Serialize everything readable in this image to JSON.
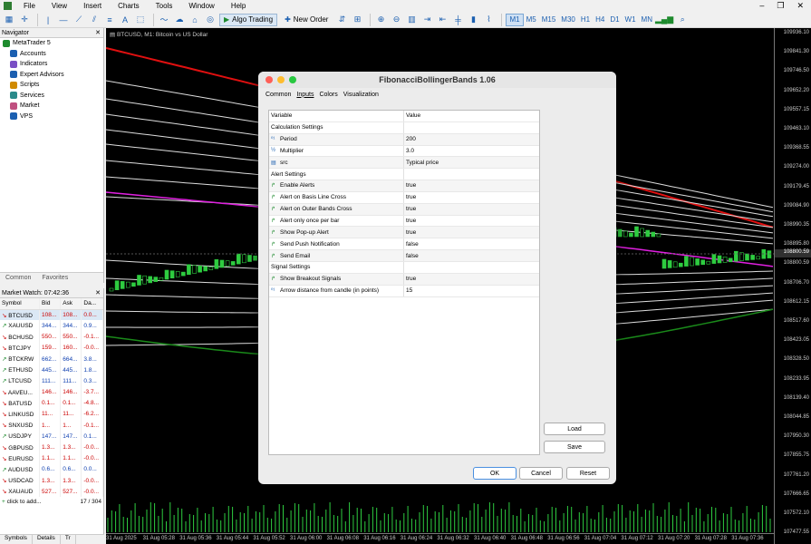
{
  "menu": {
    "items": [
      "File",
      "View",
      "Insert",
      "Charts",
      "Tools",
      "Window",
      "Help"
    ]
  },
  "toolbar": {
    "algo_trading": "Algo Trading",
    "new_order": "New Order",
    "timeframes": [
      "M1",
      "M5",
      "M15",
      "M30",
      "H1",
      "H4",
      "D1",
      "W1",
      "MN"
    ],
    "active_timeframe": "M1"
  },
  "navigator": {
    "title": "Navigator",
    "items": [
      {
        "label": "MetaTrader 5",
        "icon": "terminal-icon"
      },
      {
        "label": "Accounts",
        "icon": "accounts-icon"
      },
      {
        "label": "Indicators",
        "icon": "indicators-icon"
      },
      {
        "label": "Expert Advisors",
        "icon": "expert-advisors-icon"
      },
      {
        "label": "Scripts",
        "icon": "scripts-icon"
      },
      {
        "label": "Services",
        "icon": "services-icon"
      },
      {
        "label": "Market",
        "icon": "market-icon"
      },
      {
        "label": "VPS",
        "icon": "vps-icon"
      }
    ],
    "tabs": [
      "Common",
      "Favorites"
    ]
  },
  "market_watch": {
    "title": "Market Watch: 07:42:36",
    "columns": [
      "Symbol",
      "Bid",
      "Ask",
      "Da..."
    ],
    "rows": [
      {
        "symbol": "BTCUSD",
        "bid": "108...",
        "ask": "108...",
        "day": "0.0...",
        "up": false,
        "sel": true
      },
      {
        "symbol": "XAUUSD",
        "bid": "344...",
        "ask": "344...",
        "day": "0.9...",
        "up": true
      },
      {
        "symbol": "BCHUSD",
        "bid": "550...",
        "ask": "550...",
        "day": "-0.1...",
        "up": false
      },
      {
        "symbol": "BTCJPY",
        "bid": "159...",
        "ask": "160...",
        "day": "-0.0...",
        "up": false
      },
      {
        "symbol": "BTCKRW",
        "bid": "662...",
        "ask": "664...",
        "day": "3.8...",
        "up": true
      },
      {
        "symbol": "ETHUSD",
        "bid": "445...",
        "ask": "445...",
        "day": "1.8...",
        "up": true
      },
      {
        "symbol": "LTCUSD",
        "bid": "111...",
        "ask": "111...",
        "day": "0.3...",
        "up": true
      },
      {
        "symbol": "AAVEU...",
        "bid": "146...",
        "ask": "146...",
        "day": "-3.7...",
        "up": false
      },
      {
        "symbol": "BATUSD",
        "bid": "0.1...",
        "ask": "0.1...",
        "day": "-4.8...",
        "up": false
      },
      {
        "symbol": "LINKUSD",
        "bid": "11...",
        "ask": "11...",
        "day": "-6.2...",
        "up": false
      },
      {
        "symbol": "SNXUSD",
        "bid": "1...",
        "ask": "1...",
        "day": "-0.1...",
        "up": false
      },
      {
        "symbol": "USDJPY",
        "bid": "147...",
        "ask": "147...",
        "day": "0.1...",
        "up": true
      },
      {
        "symbol": "GBPUSD",
        "bid": "1.3...",
        "ask": "1.3...",
        "day": "-0.0...",
        "up": false
      },
      {
        "symbol": "EURUSD",
        "bid": "1.1...",
        "ask": "1.1...",
        "day": "-0.0...",
        "up": false
      },
      {
        "symbol": "AUDUSD",
        "bid": "0.6...",
        "ask": "0.6...",
        "day": "0.0...",
        "up": true
      },
      {
        "symbol": "USDCAD",
        "bid": "1.3...",
        "ask": "1.3...",
        "day": "-0.0...",
        "up": false
      },
      {
        "symbol": "XAUAUD",
        "bid": "527...",
        "ask": "527...",
        "day": "-0.0...",
        "up": false
      }
    ],
    "add_label": "click to add...",
    "count": "17 / 304",
    "tabs": [
      "Symbols",
      "Details",
      "Tr"
    ]
  },
  "chart": {
    "title": "BTCUSD, M1: Bitcoin vs US Dollar",
    "current_price": "108800.59",
    "prices": [
      "109936.10",
      "109841.30",
      "109746.50",
      "109652.20",
      "109557.15",
      "109463.10",
      "109368.55",
      "109274.00",
      "109179.45",
      "109084.90",
      "108990.35",
      "108895.80",
      "108800.59",
      "108706.70",
      "108612.15",
      "108517.60",
      "108423.05",
      "108328.50",
      "108233.95",
      "108139.40",
      "108044.85",
      "107950.30",
      "107855.75",
      "107761.20",
      "107666.65",
      "107572.10",
      "107477.55"
    ],
    "times": [
      "31 Aug 2025",
      "31 Aug 05:28",
      "31 Aug 05:36",
      "31 Aug 05:44",
      "31 Aug 05:52",
      "31 Aug 06:00",
      "31 Aug 06:08",
      "31 Aug 06:16",
      "31 Aug 06:24",
      "31 Aug 06:32",
      "31 Aug 06:40",
      "31 Aug 06:48",
      "31 Aug 06:56",
      "31 Aug 07:04",
      "31 Aug 07:12",
      "31 Aug 07:20",
      "31 Aug 07:28",
      "31 Aug 07:36"
    ]
  },
  "dialog": {
    "title": "FibonacciBollingerBands 1.06",
    "tabs": [
      "Common",
      "Inputs",
      "Colors",
      "Visualization"
    ],
    "active_tab": "Inputs",
    "header": {
      "variable": "Variable",
      "value": "Value"
    },
    "rows": [
      {
        "name": "Calculation Settings",
        "value": "",
        "type": "section"
      },
      {
        "name": "Period",
        "value": "200",
        "type": "int"
      },
      {
        "name": "Multiplier",
        "value": "3.0",
        "type": "double"
      },
      {
        "name": "src",
        "value": "Typical price",
        "type": "enum"
      },
      {
        "name": "Alert Settings",
        "value": "",
        "type": "section"
      },
      {
        "name": "Enable Alerts",
        "value": "true",
        "type": "bool"
      },
      {
        "name": "Alert on Basis Line Cross",
        "value": "true",
        "type": "bool"
      },
      {
        "name": "Alert on Outer Bands Cross",
        "value": "true",
        "type": "bool"
      },
      {
        "name": "Alert only once per bar",
        "value": "true",
        "type": "bool"
      },
      {
        "name": "Show Pop-up Alert",
        "value": "true",
        "type": "bool"
      },
      {
        "name": "Send Push Notification",
        "value": "false",
        "type": "bool"
      },
      {
        "name": "Send Email",
        "value": "false",
        "type": "bool"
      },
      {
        "name": "Signal Settings",
        "value": "",
        "type": "section"
      },
      {
        "name": "Show Breakout Signals",
        "value": "true",
        "type": "bool"
      },
      {
        "name": "Arrow distance from candle (in points)",
        "value": "15",
        "type": "int"
      }
    ],
    "load": "Load",
    "save": "Save",
    "ok": "OK",
    "cancel": "Cancel",
    "reset": "Reset"
  },
  "colors": {
    "upper_band": "#e01010",
    "basis": "#e020e0",
    "lower_band": "#1a8a1a",
    "candle": "#2ecc40",
    "bands": "#dddddd"
  }
}
